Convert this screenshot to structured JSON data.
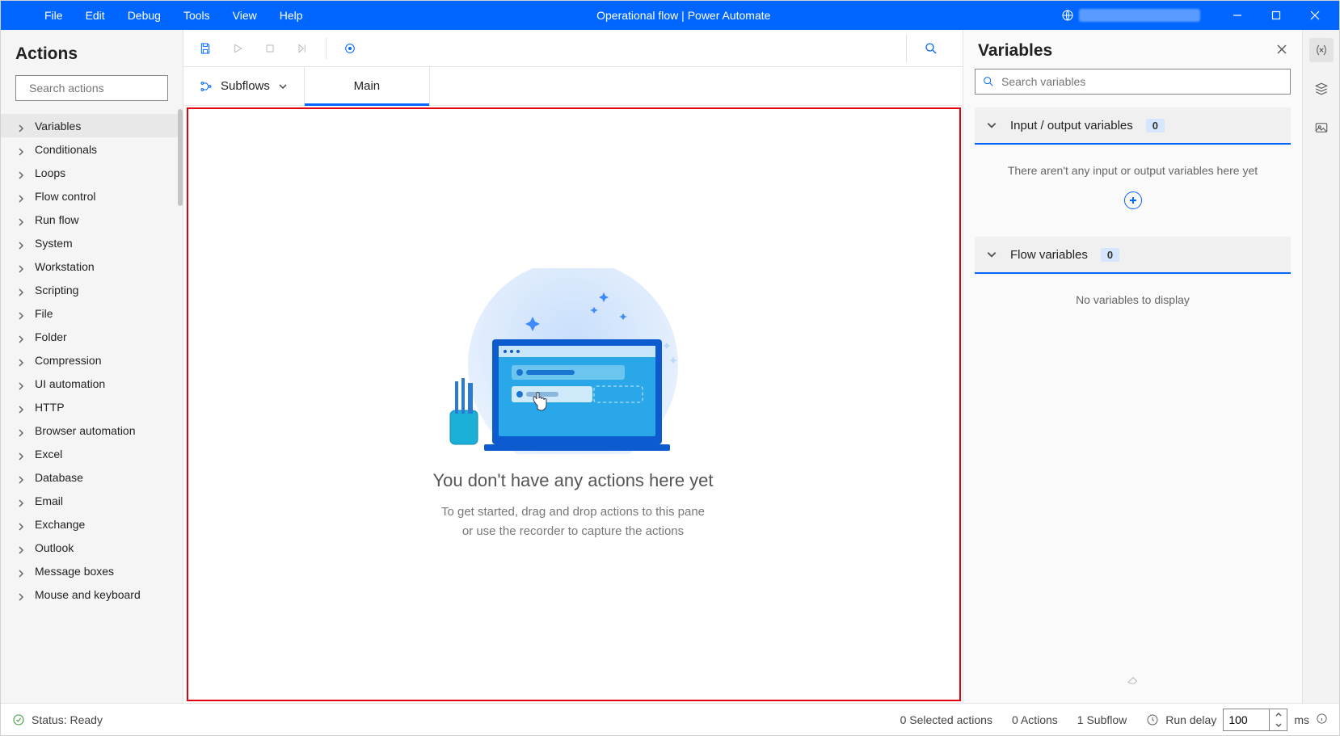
{
  "titlebar": {
    "menus": [
      "File",
      "Edit",
      "Debug",
      "Tools",
      "View",
      "Help"
    ],
    "title": "Operational flow | Power Automate"
  },
  "actions": {
    "header": "Actions",
    "search_placeholder": "Search actions",
    "categories": [
      "Variables",
      "Conditionals",
      "Loops",
      "Flow control",
      "Run flow",
      "System",
      "Workstation",
      "Scripting",
      "File",
      "Folder",
      "Compression",
      "UI automation",
      "HTTP",
      "Browser automation",
      "Excel",
      "Database",
      "Email",
      "Exchange",
      "Outlook",
      "Message boxes",
      "Mouse and keyboard"
    ]
  },
  "tabs": {
    "subflows_label": "Subflows",
    "main_label": "Main"
  },
  "empty": {
    "title": "You don't have any actions here yet",
    "sub1": "To get started, drag and drop actions to this pane",
    "sub2": "or use the recorder to capture the actions"
  },
  "variables": {
    "header": "Variables",
    "search_placeholder": "Search variables",
    "io_label": "Input / output variables",
    "io_count": "0",
    "io_empty": "There aren't any input or output variables here yet",
    "flow_label": "Flow variables",
    "flow_count": "0",
    "flow_empty": "No variables to display"
  },
  "status": {
    "ready": "Status: Ready",
    "selected": "0 Selected actions",
    "actions": "0 Actions",
    "subflows": "1 Subflow",
    "run_delay_label": "Run delay",
    "run_delay_value": "100",
    "ms": "ms"
  }
}
